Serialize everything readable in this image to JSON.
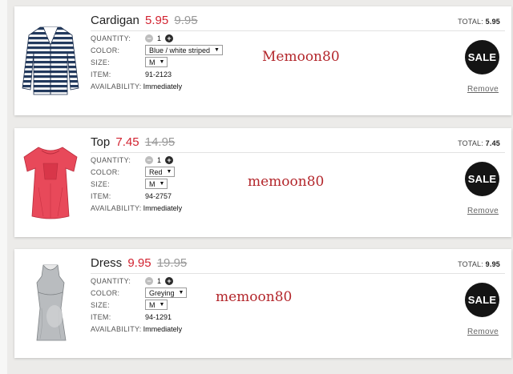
{
  "labels": {
    "quantity": "QUANTITY:",
    "color": "COLOR:",
    "size": "SIZE:",
    "item": "ITEM:",
    "availability": "AVAILABILITY:",
    "total": "TOTAL:",
    "remove": "Remove",
    "sale": "SALE"
  },
  "items": [
    {
      "name": "Cardigan",
      "price": "5.95",
      "old_price": "9.95",
      "total": "5.95",
      "quantity": "1",
      "color": "Blue / white striped",
      "size": "M",
      "item_no": "91-2123",
      "availability": "Immediately",
      "watermark": "Memoon80",
      "image_icon": "striped-cardigan-image"
    },
    {
      "name": "Top",
      "price": "7.45",
      "old_price": "14.95",
      "total": "7.45",
      "quantity": "1",
      "color": "Red",
      "size": "M",
      "item_no": "94-2757",
      "availability": "Immediately",
      "watermark": "memoon80",
      "image_icon": "red-top-image"
    },
    {
      "name": "Dress",
      "price": "9.95",
      "old_price": "19.95",
      "total": "9.95",
      "quantity": "1",
      "color": "Greying",
      "size": "M",
      "item_no": "94-1291",
      "availability": "Immediately",
      "watermark": "memoon80",
      "image_icon": "grey-dress-image"
    }
  ],
  "colors": {
    "sale_price": "#d22230",
    "old_price": "#999999",
    "sale_badge": "#141414",
    "watermark": "#b3262b"
  }
}
